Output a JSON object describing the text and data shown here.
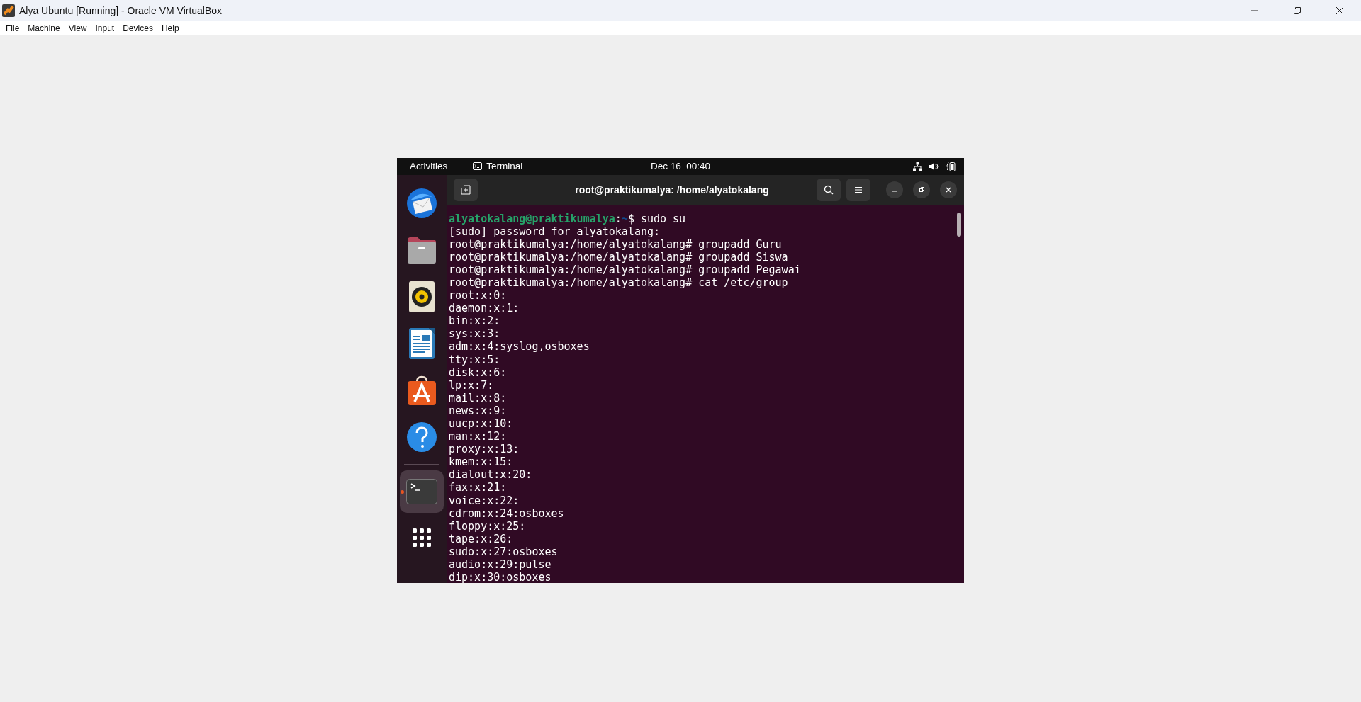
{
  "window": {
    "title": "Alya Ubuntu [Running] - Oracle VM VirtualBox"
  },
  "menu": [
    "File",
    "Machine",
    "View",
    "Input",
    "Devices",
    "Help"
  ],
  "top_bar": {
    "activities": "Activities",
    "app": "Terminal",
    "clock": "Dec 16  00:40"
  },
  "dock": [
    {
      "kind": "mail",
      "active": false
    },
    {
      "kind": "files",
      "active": false
    },
    {
      "kind": "music",
      "active": false
    },
    {
      "kind": "writer",
      "active": false
    },
    {
      "kind": "store",
      "active": false
    },
    {
      "kind": "help",
      "active": false
    },
    {
      "kind": "terminal",
      "active": true
    }
  ],
  "terminal": {
    "title": "root@praktikumalya: /home/alyatokalang",
    "lines": [
      {
        "kind": "prompt",
        "user": "alyatokalang@praktikumalya",
        "sep": ":",
        "path": "~",
        "rest": "$ sudo su"
      },
      {
        "kind": "output",
        "text": "[sudo] password for alyatokalang:"
      },
      {
        "kind": "output",
        "text": "root@praktikumalya:/home/alyatokalang# groupadd Guru"
      },
      {
        "kind": "output",
        "text": "root@praktikumalya:/home/alyatokalang# groupadd Siswa"
      },
      {
        "kind": "output",
        "text": "root@praktikumalya:/home/alyatokalang# groupadd Pegawai"
      },
      {
        "kind": "output",
        "text": "root@praktikumalya:/home/alyatokalang# cat /etc/group"
      },
      {
        "kind": "output",
        "text": "root:x:0:"
      },
      {
        "kind": "output",
        "text": "daemon:x:1:"
      },
      {
        "kind": "output",
        "text": "bin:x:2:"
      },
      {
        "kind": "output",
        "text": "sys:x:3:"
      },
      {
        "kind": "output",
        "text": "adm:x:4:syslog,osboxes"
      },
      {
        "kind": "output",
        "text": "tty:x:5:"
      },
      {
        "kind": "output",
        "text": "disk:x:6:"
      },
      {
        "kind": "output",
        "text": "lp:x:7:"
      },
      {
        "kind": "output",
        "text": "mail:x:8:"
      },
      {
        "kind": "output",
        "text": "news:x:9:"
      },
      {
        "kind": "output",
        "text": "uucp:x:10:"
      },
      {
        "kind": "output",
        "text": "man:x:12:"
      },
      {
        "kind": "output",
        "text": "proxy:x:13:"
      },
      {
        "kind": "output",
        "text": "kmem:x:15:"
      },
      {
        "kind": "output",
        "text": "dialout:x:20:"
      },
      {
        "kind": "output",
        "text": "fax:x:21:"
      },
      {
        "kind": "output",
        "text": "voice:x:22:"
      },
      {
        "kind": "output",
        "text": "cdrom:x:24:osboxes"
      },
      {
        "kind": "output",
        "text": "floppy:x:25:"
      },
      {
        "kind": "output",
        "text": "tape:x:26:"
      },
      {
        "kind": "output",
        "text": "sudo:x:27:osboxes"
      },
      {
        "kind": "output",
        "text": "audio:x:29:pulse"
      },
      {
        "kind": "output",
        "text": "dip:x:30:osboxes"
      }
    ]
  }
}
